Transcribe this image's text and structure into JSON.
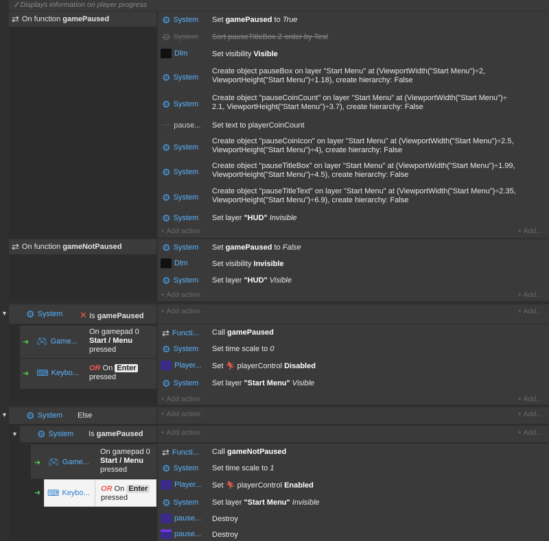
{
  "comment": "Displays information on player progress",
  "events": {
    "gamePaused": {
      "cond": {
        "prefix": "On function",
        "name": "gamePaused"
      },
      "actions": [
        {
          "obj": "System",
          "text_a": "Set ",
          "text_b": "gamePaused",
          "text_c": " to ",
          "text_d": "True"
        },
        {
          "obj": "System",
          "text": "Sort pauseTitleBox Z order by Test"
        },
        {
          "obj": "Dlm",
          "text_a": "Set visibility ",
          "text_b": "Visible"
        },
        {
          "obj": "System",
          "line1": "Create object  pauseBox on layer \"Start Menu\" at (ViewportWidth(\"Start Menu\")÷2,",
          "line2": "ViewportHeight(\"Start Menu\")÷1.18), create hierarchy: False"
        },
        {
          "obj": "System",
          "line1": "Create object \"pauseCoinCount\" on layer \"Start Menu\" at (ViewportWidth(\"Start Menu\")÷",
          "line2": "2.1, ViewportHeight(\"Start Menu\")÷3.7), create hierarchy: False"
        },
        {
          "obj": "pause...",
          "text": "Set text to playerCoinCount"
        },
        {
          "obj": "System",
          "line1": "Create object \"pauseCoinIcon\" on layer \"Start Menu\" at (ViewportWidth(\"Start Menu\")÷2.5,",
          "line2": "ViewportHeight(\"Start Menu\")÷4), create hierarchy: False"
        },
        {
          "obj": "System",
          "line1": "Create object \"pauseTitleBox\" on layer \"Start Menu\" at (ViewportWidth(\"Start Menu\")÷1.99,",
          "line2": "ViewportHeight(\"Start Menu\")÷4.5), create hierarchy: False"
        },
        {
          "obj": "System",
          "line1": "Create object \"pauseTitleText\" on layer \"Start Menu\" at (ViewportWidth(\"Start Menu\")÷2.35,",
          "line2": "ViewportHeight(\"Start Menu\")÷6.9), create hierarchy: False"
        },
        {
          "obj": "System",
          "text_a": "Set layer ",
          "text_b": "\"HUD\"",
          "text_c": " Invisible"
        }
      ]
    },
    "gameNotPaused": {
      "cond": {
        "prefix": "On function",
        "name": "gameNotPaused"
      },
      "actions": [
        {
          "obj": "System",
          "text_a": "Set ",
          "text_b": "gamePaused",
          "text_c": " to ",
          "text_d": "False"
        },
        {
          "obj": "Dlm",
          "text_a": "Set visibility ",
          "text_b": "Invisible"
        },
        {
          "obj": "System",
          "text_a": "Set layer ",
          "text_b": "\"HUD\"",
          "text_c": " Visible"
        }
      ]
    },
    "isPaused": {
      "obj": "System",
      "cond_prefix": "Is",
      "cond_name": "gamePaused",
      "sub": {
        "gamepad_obj": "Game...",
        "gamepad_text1": "On gamepad 0",
        "gamepad_text2": "Start / Menu",
        "gamepad_text3": "pressed",
        "keyboard_obj": "Keybo...",
        "or": "OR",
        "on": " On ",
        "key": "Enter",
        "pressed": "pressed",
        "actions": [
          {
            "obj": "Functi...",
            "text_a": "Call ",
            "text_b": "gamePaused"
          },
          {
            "obj": "System",
            "text_a": "Set time scale to ",
            "text_b": "0"
          },
          {
            "obj": "Player...",
            "text_a": "Set ",
            "text_b": "playerControl",
            "text_c": " Disabled"
          },
          {
            "obj": "System",
            "text_a": "Set layer ",
            "text_b": "\"Start Menu\"",
            "text_c": " Visible"
          }
        ]
      }
    },
    "else": {
      "obj": "System",
      "label": "Else",
      "inner": {
        "obj": "System",
        "cond_prefix": "Is",
        "cond_name": "gamePaused",
        "gamepad_obj": "Game...",
        "gamepad_text1": "On gamepad 0",
        "gamepad_text2": "Start / Menu",
        "gamepad_text3": "pressed",
        "keyboard_obj": "Keybo...",
        "or": "OR",
        "on": " On ",
        "key": "Enter",
        "pressed": "pressed",
        "actions": [
          {
            "obj": "Functi...",
            "text_a": "Call ",
            "text_b": "gameNotPaused"
          },
          {
            "obj": "System",
            "text_a": "Set time scale to ",
            "text_b": "1"
          },
          {
            "obj": "Player...",
            "text_a": "Set ",
            "text_b": "playerControl",
            "text_c": " Enabled"
          },
          {
            "obj": "System",
            "text_a": "Set layer ",
            "text_b": "\"Start Menu\"",
            "text_c": " Invisible"
          },
          {
            "obj": "pause...",
            "text": "Destroy"
          },
          {
            "obj": "pause...",
            "text": "Destroy"
          }
        ]
      }
    }
  },
  "add_action": "+ Add action",
  "add_short": "+ Add...",
  "colors": {
    "accent": "#5ab4ff",
    "purple": "#4a2a8a",
    "or": "#e65c4f"
  }
}
